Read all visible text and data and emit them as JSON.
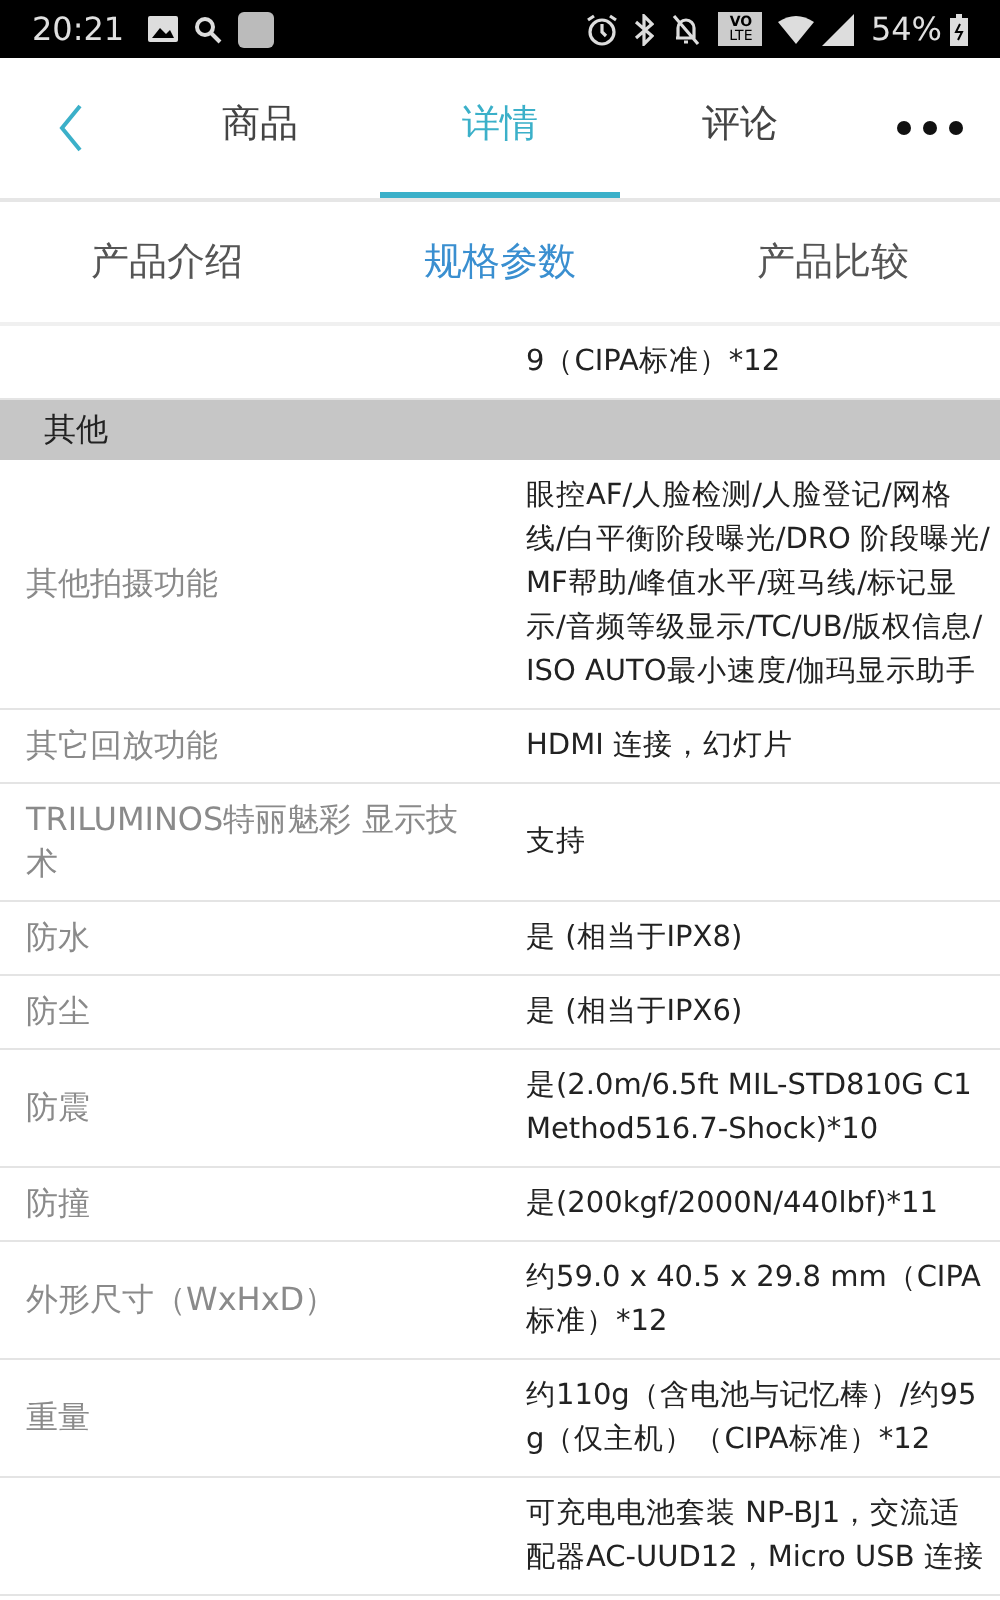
{
  "status_bar": {
    "time": "20:21",
    "network_badge": [
      "VO",
      "LTE"
    ],
    "battery": "54%"
  },
  "nav": {
    "tabs": [
      {
        "label": "商品",
        "selected": false
      },
      {
        "label": "详情",
        "selected": true
      },
      {
        "label": "评论",
        "selected": false
      }
    ]
  },
  "sub_tabs": [
    {
      "label": "产品介绍",
      "selected": false
    },
    {
      "label": "规格参数",
      "selected": true
    },
    {
      "label": "产品比较",
      "selected": false
    }
  ],
  "specs": [
    {
      "kind": "row",
      "value": "9（CIPA标准）*12"
    },
    {
      "kind": "section",
      "label": "其他"
    },
    {
      "kind": "row",
      "label": "其他拍摄功能",
      "value": "眼控AF/人脸检测/人脸登记/网格线/白平衡阶段曝光/DRO 阶段曝光/MF帮助/峰值水平/斑马线/标记显示/音频等级显示/TC/UB/版权信息/ISO AUTO最小速度/伽玛显示助手"
    },
    {
      "kind": "row",
      "label": "其它回放功能",
      "value": "HDMI 连接，幻灯片"
    },
    {
      "kind": "row",
      "label": "TRILUMINOS特丽魅彩 显示技术",
      "value": "支持"
    },
    {
      "kind": "row",
      "label": "防水",
      "value": "是 (相当于IPX8)"
    },
    {
      "kind": "row",
      "label": "防尘",
      "value": "是 (相当于IPX6)"
    },
    {
      "kind": "row",
      "label": "防震",
      "value": "是(2.0m/6.5ft MIL-STD810G C1 Method516.7-Shock)*10"
    },
    {
      "kind": "row",
      "label": "防撞",
      "value": "是(200kgf/2000N/440lbf)*11"
    },
    {
      "kind": "row",
      "label": "外形尺寸（WxHxD）",
      "value": "约59.0 x 40.5 x 29.8 mm（CIPA标准）*12"
    },
    {
      "kind": "row",
      "label": "重量",
      "value": "约110g（含电池与记忆棒）/约95g（仅主机）（CIPA标准）*12"
    },
    {
      "kind": "row",
      "value": "可充电电池套装 NP-BJ1，交流适配器AC-UUD12，Micro USB 连接"
    }
  ]
}
